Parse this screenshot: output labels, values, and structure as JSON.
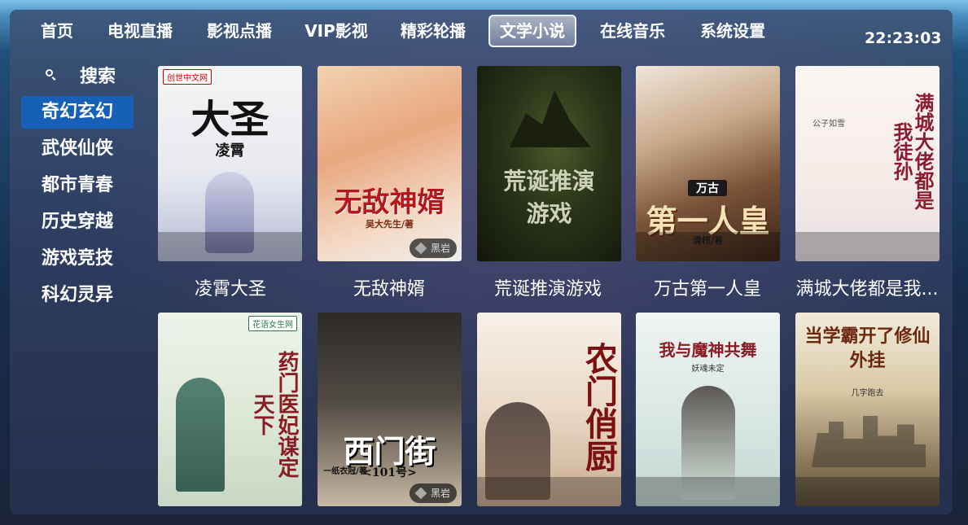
{
  "nav": {
    "items": [
      "首页",
      "电视直播",
      "影视点播",
      "VIP影视",
      "精彩轮播",
      "文学小说",
      "在线音乐",
      "系统设置"
    ],
    "active": "文学小说"
  },
  "clock": "22:23:03",
  "sidebar": {
    "search_label": "搜索",
    "categories": [
      "奇幻玄幻",
      "武侠仙侠",
      "都市青春",
      "历史穿越",
      "游戏竞技",
      "科幻灵异"
    ],
    "active": "奇幻玄幻"
  },
  "books": [
    {
      "title": "凌霄大圣",
      "cover_text": "大圣",
      "cover_sub": "凌霄",
      "publisher": "创世中文网"
    },
    {
      "title": "无敌神婿",
      "cover_text": "无敌神婿",
      "cover_sub": "吴大先生/著",
      "badge": "黑岩"
    },
    {
      "title": "荒诞推演游戏",
      "cover_text": "荒诞推演",
      "cover_sub": "游戏"
    },
    {
      "title": "万古第一人皇",
      "cover_text": "第一人皇",
      "cover_sub": "万古",
      "author": "清栉/著"
    },
    {
      "title": "满城大佬都是我...",
      "cover_text": "满城大佬都是我徒孙",
      "author": "公子如雪"
    },
    {
      "title": "",
      "cover_text": "药门医妃谋定天下",
      "publisher": "花语女生网"
    },
    {
      "title": "",
      "cover_text": "西门街",
      "cover_sub": "<101号>",
      "author": "一纸衣冠/著",
      "badge": "黑岩"
    },
    {
      "title": "",
      "cover_text": "农门俏厨"
    },
    {
      "title": "",
      "cover_text": "我与魔神共舞",
      "author": "妖魂未定"
    },
    {
      "title": "",
      "cover_text": "当学霸开了修仙外挂",
      "author": "几字跑去"
    }
  ],
  "colors": {
    "active_category": "#1660b8",
    "accent_white": "#ffffff"
  }
}
